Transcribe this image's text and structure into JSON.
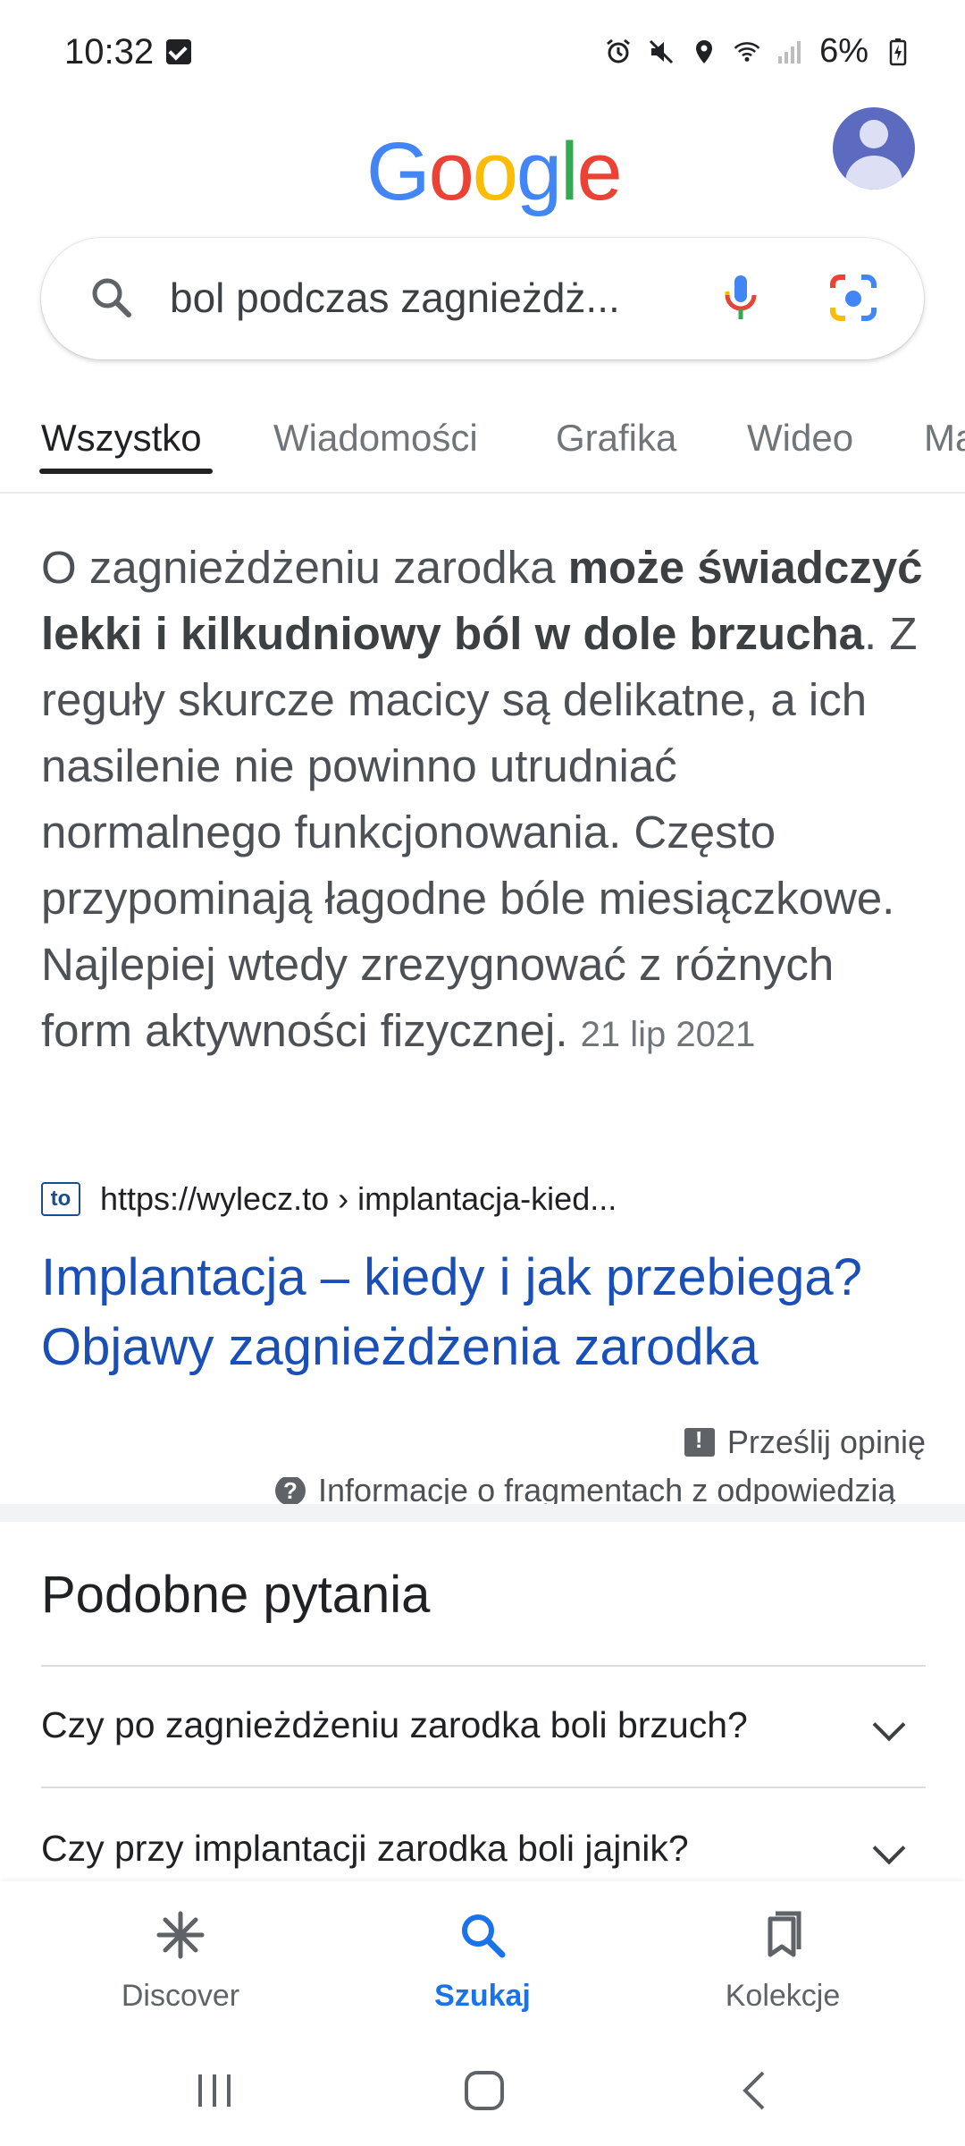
{
  "status_bar": {
    "time": "10:32",
    "battery": "6%"
  },
  "header": {
    "logo_text": "Google"
  },
  "search": {
    "query": "bol podczas zagnieżdż..."
  },
  "tabs": [
    {
      "label": "Wszystko",
      "active": true
    },
    {
      "label": "Wiadomości"
    },
    {
      "label": "Grafika"
    },
    {
      "label": "Wideo"
    },
    {
      "label": "Ma"
    }
  ],
  "snippet": {
    "text_start": "O zagnieżdżeniu zarodka ",
    "text_bold": "może świadczyć lekki i kilkudniowy ból w dole brzucha",
    "text_end": ". Z reguły skurcze macicy są delikatne, a ich nasilenie nie powinno utrudniać normalnego funkcjonowania. Często przypominają łagodne bóle miesiączkowe. Najlepiej wtedy zrezygnować z różnych form aktywności fizycznej. ",
    "date": "21 lip 2021"
  },
  "source": {
    "favicon_text": "to",
    "url": "https://wylecz.to › implantacja-kied..."
  },
  "result": {
    "title": "Implantacja – kiedy i jak przebiega? Objawy zagnieżdżenia zarodka"
  },
  "feedback": {
    "label": "Prześlij opinię"
  },
  "about": {
    "label": "Informacje o fragmentach z odpowiedzią"
  },
  "paa": {
    "title": "Podobne pytania",
    "questions": [
      "Czy po zagnieżdżeniu zarodka boli brzuch?",
      "Czy przy implantacji zarodka boli jajnik?"
    ]
  },
  "bottom_nav": [
    {
      "label": "Discover",
      "icon": "asterisk-icon"
    },
    {
      "label": "Szukaj",
      "icon": "search-icon",
      "active": true
    },
    {
      "label": "Kolekcje",
      "icon": "bookmarks-icon"
    }
  ],
  "colors": {
    "link": "#1a4fb8",
    "active_nav": "#1a73e8",
    "google_blue": "#4285F4",
    "google_red": "#EA4335",
    "google_yellow": "#FBBC05",
    "google_green": "#34A853"
  }
}
